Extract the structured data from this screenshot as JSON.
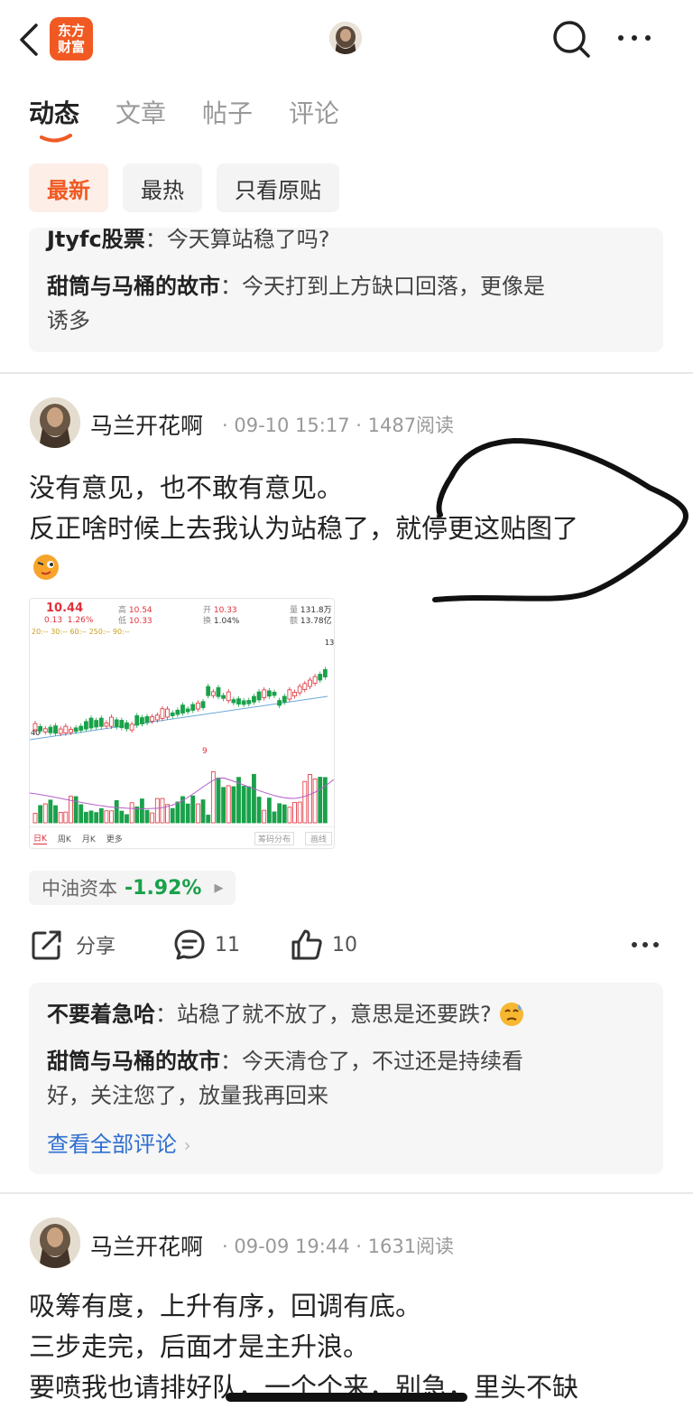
{
  "header": {
    "logo_line1": "东方",
    "logo_line2": "财富"
  },
  "tabs": [
    "动态",
    "文章",
    "帖子",
    "评论"
  ],
  "filters": [
    "最新",
    "最热",
    "只看原贴"
  ],
  "top_comments": [
    {
      "name": "Jtyfc股票",
      "sep": "：",
      "text": "今天算站稳了吗?"
    },
    {
      "name": "甜筒与马桶的故市",
      "sep": "：",
      "text": "今天打到上方缺口回落，更像是",
      "text2": "诱多"
    }
  ],
  "post1": {
    "author": "马兰开花啊",
    "time": "09-10 15:17",
    "reads": "1487阅读",
    "line1": "没有意见，也不敢有意见。",
    "line2": "反正啥时候上去我认为站稳了，就停更这贴图了",
    "stock_name": "中油资本",
    "stock_change": "-1.92%",
    "share_label": "分享",
    "comment_count": "11",
    "like_count": "10",
    "chart": {
      "price": "10.44",
      "change": "0.13",
      "change_pct": "1.26%",
      "high_label": "高",
      "high": "10.54",
      "low_label": "低",
      "low": "10.33",
      "open_label": "开",
      "open": "10.33",
      "turn_label": "换",
      "turn": "1.04%",
      "vol_label": "量",
      "vol": "131.8万",
      "amt_label": "额",
      "amt": "13.78亿",
      "ma": "20:--  30:--  60:--  250:--  90:--",
      "tabs": [
        "日K",
        "周K",
        "月K",
        "更多"
      ],
      "btn1": "筹码分布",
      "btn2": "画线",
      "tick_top": "13",
      "tick_left": "40",
      "mark": "9"
    },
    "comments": [
      {
        "name": "不要着急哈",
        "sep": "：",
        "text": "站稳了就不放了，意思是还要跌?"
      },
      {
        "name": "甜筒与马桶的故市",
        "sep": "：",
        "text": "今天清仓了，不过还是持续看",
        "text2": "好，关注您了，放量我再回来"
      }
    ],
    "view_all": "查看全部评论"
  },
  "post2": {
    "author": "马兰开花啊",
    "time": "09-09 19:44",
    "reads": "1631阅读",
    "line1": "吸筹有度，上升有序，回调有底。",
    "line2": "三步走完，后面才是主升浪。",
    "line3": "要喷我也请排好队，一个个来，别急，里头不缺"
  },
  "colors": {
    "accent": "#f05a22",
    "up": "#e0303a",
    "down": "#1aa14a",
    "link": "#2f6fd0"
  }
}
